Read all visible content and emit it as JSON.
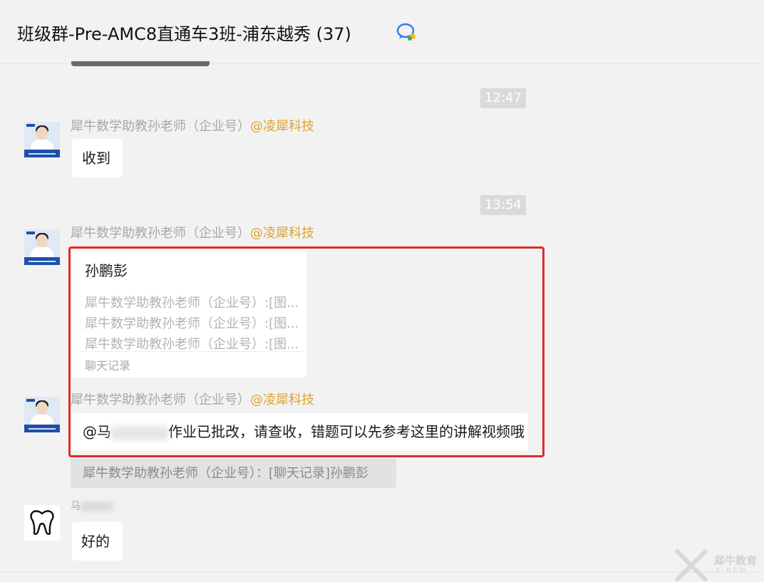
{
  "header": {
    "title": "班级群-Pre-AMC8直通车3班-浦东越秀 (37)"
  },
  "times": [
    "12:47",
    "13:54"
  ],
  "messages": [
    {
      "sender_name": "犀牛数学助教孙老师（企业号）",
      "sender_corp": "@凌犀科技",
      "text": "收到"
    },
    {
      "sender_name": "犀牛数学助教孙老师（企业号）",
      "sender_corp": "@凌犀科技",
      "record": {
        "title": "孙鹏彭",
        "lines": [
          "犀牛数学助教孙老师（企业号）:[图...",
          "犀牛数学助教孙老师（企业号）:[图...",
          "犀牛数学助教孙老师（企业号）:[图..."
        ],
        "footer": "聊天记录"
      }
    },
    {
      "sender_name": "犀牛数学助教孙老师（企业号）",
      "sender_corp": "@凌犀科技",
      "text_prefix": "@马",
      "text_suffix": "作业已批改，请查收，错题可以先参考这里的讲解视频哦",
      "quote": "犀牛数学助教孙老师（企业号）：[聊天记录]孙鹏彭"
    },
    {
      "sender_name": "马",
      "text": "好的"
    }
  ],
  "watermark": {
    "brand": "犀牛教育",
    "sub": "X-NEW"
  },
  "colors": {
    "highlight_border": "#e02a2a",
    "corp_tag": "#e0a32a",
    "background": "#f2f2f2"
  }
}
